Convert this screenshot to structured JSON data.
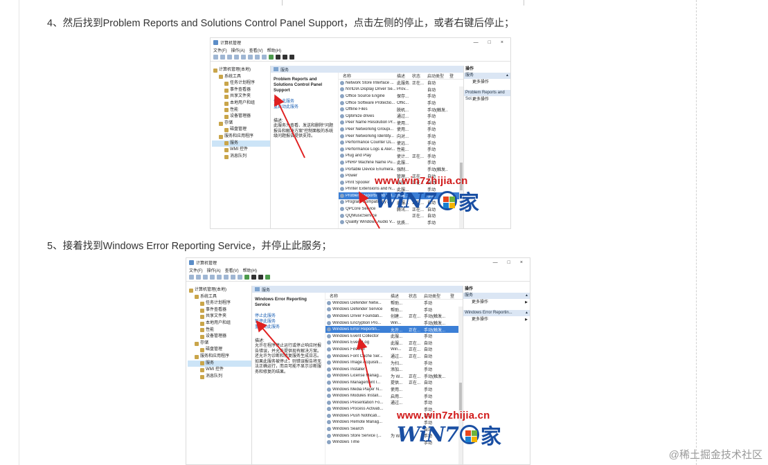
{
  "steps": {
    "step4": "4、然后找到Problem Reports and Solutions Control Panel Support，点击左侧的停止，或者右键后停止；",
    "step5": "5、接着找到Windows Error Reporting Service，并停止此服务；"
  },
  "watermark": {
    "url": "www.win7zhijia.cn",
    "logo_text": "WiN7",
    "logo_char": "家",
    "corner": "@稀土掘金技术社区"
  },
  "window": {
    "title": "计算机管理",
    "controls": [
      "—",
      "□",
      "×"
    ],
    "menu": [
      "文件(F)",
      "操作(A)",
      "查看(V)",
      "帮助(H)"
    ],
    "tree": [
      {
        "label": "计算机管理(本地)",
        "level": 0
      },
      {
        "label": "系统工具",
        "level": 1
      },
      {
        "label": "任务计划程序",
        "level": 2
      },
      {
        "label": "事件查看器",
        "level": 2
      },
      {
        "label": "共享文件夹",
        "level": 2
      },
      {
        "label": "本地用户和组",
        "level": 2
      },
      {
        "label": "性能",
        "level": 2
      },
      {
        "label": "设备管理器",
        "level": 2
      },
      {
        "label": "存储",
        "level": 1
      },
      {
        "label": "磁盘管理",
        "level": 2
      },
      {
        "label": "服务和应用程序",
        "level": 1
      },
      {
        "label": "服务",
        "level": 2,
        "selected": true
      },
      {
        "label": "WMI 控件",
        "level": 2
      },
      {
        "label": "消息队列",
        "level": 2
      }
    ],
    "services_header": "服务",
    "columns": [
      "名称",
      "描述",
      "状态",
      "启动类型",
      "登"
    ],
    "actions_header": "操作",
    "actions_section": "服务",
    "more_actions": "更多操作"
  },
  "shot1": {
    "desc_title": "Problem Reports and Solutions Control Panel Support",
    "links": [
      "停止此服务",
      "重启动此服务"
    ],
    "desc_label": "描述:",
    "desc_text": "此服务为查看、发送和删除\"问题报告和解决方案\"控制面板的系统级问题报告提供支持。",
    "actions_selected": "Problem Reports and Sol...",
    "rows": [
      {
        "name": "Network Store Interface ...",
        "desc": "此服务...",
        "status": "正在...",
        "start": "自动"
      },
      {
        "name": "NVIDIA Display Driver Se...",
        "desc": "Prov...",
        "status": "",
        "start": "自动"
      },
      {
        "name": "Office Source Engine",
        "desc": "保存...",
        "status": "",
        "start": "手动"
      },
      {
        "name": "Office Software Protectio...",
        "desc": "Offic...",
        "status": "",
        "start": "手动"
      },
      {
        "name": "Offline Files",
        "desc": "脱机...",
        "status": "",
        "start": "手动(触发..."
      },
      {
        "name": "Optimize drives",
        "desc": "通过...",
        "status": "",
        "start": "手动"
      },
      {
        "name": "Peer Name Resolution Pr...",
        "desc": "使用...",
        "status": "",
        "start": "手动"
      },
      {
        "name": "Peer Networking Groupi...",
        "desc": "使用...",
        "status": "",
        "start": "手动"
      },
      {
        "name": "Peer Networking Identity...",
        "desc": "向对...",
        "status": "",
        "start": "手动"
      },
      {
        "name": "Performance Counter DL...",
        "desc": "使远...",
        "status": "",
        "start": "手动"
      },
      {
        "name": "Performance Logs & Aler...",
        "desc": "性能...",
        "status": "",
        "start": "手动"
      },
      {
        "name": "Plug and Play",
        "desc": "使计...",
        "status": "正在...",
        "start": "手动"
      },
      {
        "name": "PNRP Machine Name Pu...",
        "desc": "此服...",
        "status": "",
        "start": "手动"
      },
      {
        "name": "Portable Device Enumera...",
        "desc": "强制...",
        "status": "",
        "start": "手动(触发..."
      },
      {
        "name": "Power",
        "desc": "管理...",
        "status": "正在...",
        "start": "自动"
      },
      {
        "name": "Print Spooler",
        "desc": "该服...",
        "status": "正在...",
        "start": "自动"
      },
      {
        "name": "Printer Extensions and N...",
        "desc": "此服...",
        "status": "",
        "start": "手动"
      },
      {
        "name": "Problem Reports and Sol...",
        "desc": "此服...",
        "status": "",
        "start": "手动",
        "selected": true
      },
      {
        "name": "Program Compatibility A...",
        "desc": "此服...",
        "status": "正在...",
        "start": "自动"
      },
      {
        "name": "QPCore Service",
        "desc": "腾讯...",
        "status": "正在...",
        "start": "自动"
      },
      {
        "name": "QQMusicService",
        "desc": "",
        "status": "正在...",
        "start": "自动"
      },
      {
        "name": "Quality Windows Audio V...",
        "desc": "优质...",
        "status": "",
        "start": "手动"
      }
    ]
  },
  "shot2": {
    "desc_title": "Windows Error Reporting Service",
    "links": [
      "停止此服务",
      "暂停此服务",
      "重启动此服务"
    ],
    "desc_label": "描述:",
    "desc_text": "允许在程序停止运行或停止响应时报告错误，并允许提供现有解决方案。还允许为诊断和修复服务生成日志。如果此服务被停止，则错误报告将无法正确运行，而且可能不显示诊断服务和修复的结果。",
    "actions_selected": "Windows Error Reportin...",
    "rows": [
      {
        "name": "Windows Defender Netw...",
        "desc": "帮助...",
        "status": "",
        "start": "手动"
      },
      {
        "name": "Windows Defender Service",
        "desc": "帮助...",
        "status": "",
        "start": "手动"
      },
      {
        "name": "Windows Driver Foundati...",
        "desc": "创建...",
        "status": "正在...",
        "start": "手动(触发..."
      },
      {
        "name": "Windows Encryption Pro...",
        "desc": "Win...",
        "status": "",
        "start": "手动(触发..."
      },
      {
        "name": "Windows Error Reportin...",
        "desc": "允许...",
        "status": "正在...",
        "start": "手动(触发...",
        "selected": true
      },
      {
        "name": "Windows Event Collector",
        "desc": "此服...",
        "status": "",
        "start": "手动"
      },
      {
        "name": "Windows Event Log",
        "desc": "此服...",
        "status": "正在...",
        "start": "自动"
      },
      {
        "name": "Windows Firewall",
        "desc": "Win...",
        "status": "正在...",
        "start": "自动"
      },
      {
        "name": "Windows Font Cache Ser...",
        "desc": "通过...",
        "status": "正在...",
        "start": "自动"
      },
      {
        "name": "Windows Image Acquisiti...",
        "desc": "为扫...",
        "status": "",
        "start": "手动"
      },
      {
        "name": "Windows Installer",
        "desc": "添加...",
        "status": "",
        "start": "手动"
      },
      {
        "name": "Windows License Manag...",
        "desc": "为 W...",
        "status": "正在...",
        "start": "手动(触发..."
      },
      {
        "name": "Windows Management I...",
        "desc": "提供...",
        "status": "正在...",
        "start": "自动"
      },
      {
        "name": "Windows Media Player N...",
        "desc": "使用...",
        "status": "",
        "start": "手动"
      },
      {
        "name": "Windows Modules Install...",
        "desc": "启用...",
        "status": "",
        "start": "手动"
      },
      {
        "name": "Windows Presentation Fo...",
        "desc": "通过...",
        "status": "",
        "start": "手动"
      },
      {
        "name": "Windows Process Activati...",
        "desc": "",
        "status": "",
        "start": "手动"
      },
      {
        "name": "Windows Push Notificati...",
        "desc": "",
        "status": "",
        "start": "自动"
      },
      {
        "name": "Windows Remote Manag...",
        "desc": "",
        "status": "",
        "start": "手动"
      },
      {
        "name": "Windows Search",
        "desc": "",
        "status": "",
        "start": "自动"
      },
      {
        "name": "Windows Store Service (...",
        "desc": "为 W...",
        "status": "",
        "start": "手动"
      },
      {
        "name": "Windows Time",
        "desc": "",
        "status": "",
        "start": "手动"
      }
    ]
  }
}
